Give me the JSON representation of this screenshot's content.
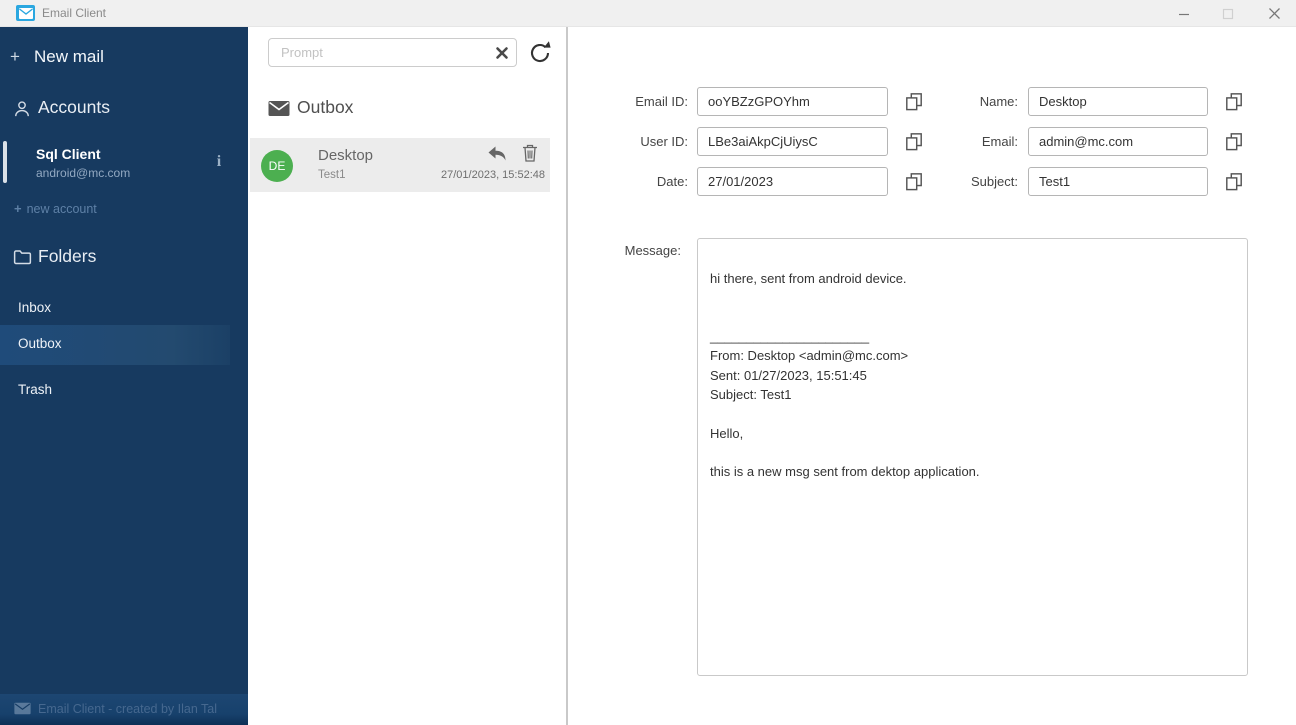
{
  "window": {
    "title": "Email Client"
  },
  "icons": {
    "plus": "+",
    "info": "i"
  },
  "sidebar": {
    "new_mail_label": "New mail",
    "accounts_header": "Accounts",
    "account": {
      "name": "Sql Client",
      "email": "android@mc.com"
    },
    "new_account_label": "new account",
    "folders_header": "Folders",
    "folders": [
      {
        "label": "Inbox",
        "selected": false
      },
      {
        "label": "Outbox",
        "selected": true
      },
      {
        "label": "Trash",
        "selected": false
      }
    ],
    "footer": "Email Client - created by Ilan Tal"
  },
  "list": {
    "search_placeholder": "Prompt",
    "header": "Outbox",
    "items": [
      {
        "initials": "DE",
        "title": "Desktop",
        "subtitle": "Test1",
        "timestamp": "27/01/2023, 15:52:48"
      }
    ]
  },
  "detail": {
    "fields": [
      {
        "label": "Email ID:",
        "value": "ooYBZzGPOYhm"
      },
      {
        "label": "User ID:",
        "value": "LBe3aiAkpCjUiysC"
      },
      {
        "label": "Date:",
        "value": "27/01/2023"
      },
      {
        "label": "Name:",
        "value": "Desktop"
      },
      {
        "label": "Email:",
        "value": "admin@mc.com"
      },
      {
        "label": "Subject:",
        "value": "Test1"
      }
    ],
    "message_label": "Message:",
    "message": "\nhi there, sent from android device.\n\n\n______________________\nFrom: Desktop <admin@mc.com>\nSent: 01/27/2023, 15:51:45\nSubject: Test1\n\nHello,\n\nthis is a new msg sent from dektop application."
  },
  "colors": {
    "sidebar_bg": "#173a60",
    "sidebar_selected": "#1f4b7a",
    "avatar_green": "#4caf50",
    "app_icon_blue": "#2aa7e0",
    "list_item_bg": "#ececec",
    "titlebar_bg": "#f0f0f0"
  }
}
